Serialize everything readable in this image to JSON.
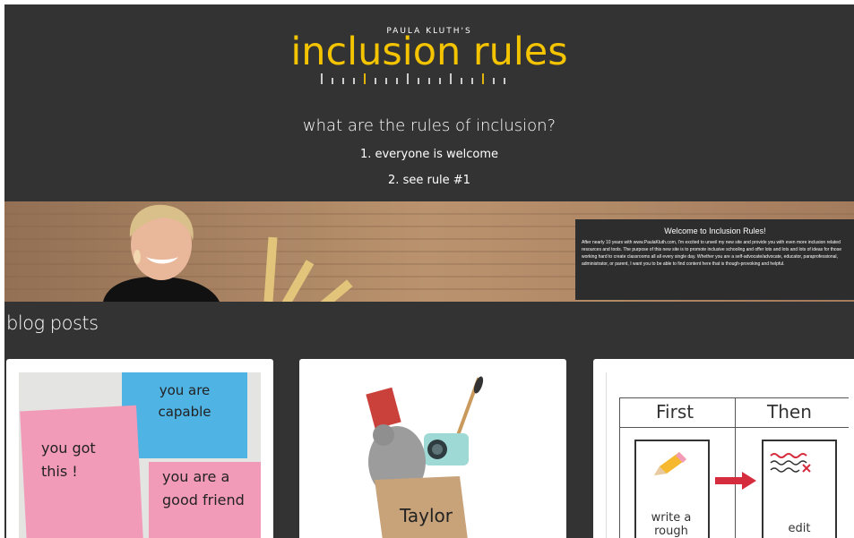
{
  "header": {
    "brand_small": "PAULA KLUTH'S",
    "brand_logo": "inclusion rules",
    "tagline": "what are the rules of inclusion?",
    "rule_1": "1. everyone is welcome",
    "rule_2": "2. see rule #1"
  },
  "welcome": {
    "title": "Welcome to Inclusion Rules!",
    "body": "After nearly 10 years with www.PaulaKluth.com, I'm excited to unveil my new site and provide you with even more inclusion related resources and tools. The purpose of this new site is to promote inclusive schooling and offer lots and lots and lots of ideas for those working hard to create classrooms all all every single day. Whether you are a self-advocate/advocate, educator, paraprofessional, administrator, or parent, I want you to be able to find content here that is though-provoking and helpful."
  },
  "blog": {
    "heading": "blog posts",
    "cards": [
      {
        "notes": [
          "you are capable",
          "you got this !",
          "you are a good friend"
        ]
      },
      {
        "bag_label": "Taylor"
      },
      {
        "col_left": "First",
        "col_right": "Then",
        "left_caption": "write a rough draft",
        "right_caption": "edit"
      }
    ]
  },
  "colors": {
    "background": "#333333",
    "brand_yellow": "#f5c400",
    "sticky_blue": "#4fb3e3",
    "sticky_pink": "#f29bb8"
  },
  "icons": [
    "ruler-graphic",
    "arrow-right-icon",
    "pencil-icon"
  ]
}
